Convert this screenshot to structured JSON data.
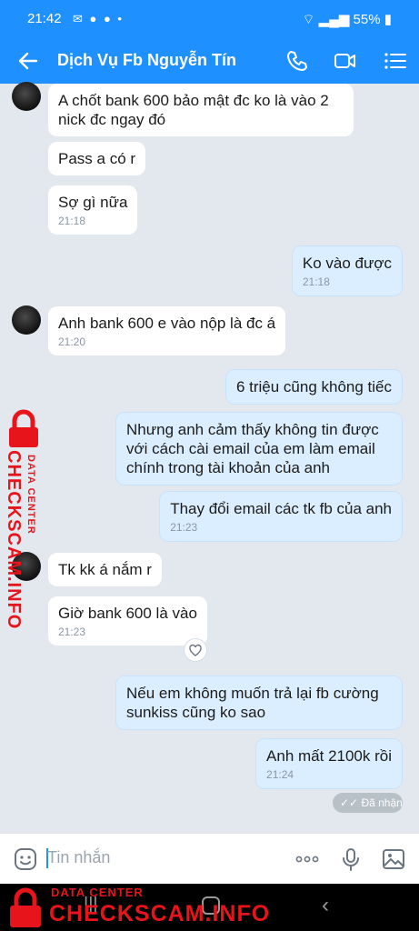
{
  "status_bar": {
    "time": "21:42",
    "battery": "55%"
  },
  "header": {
    "title": "Dịch Vụ Fb Nguyễn Tín"
  },
  "messages": [
    {
      "text": "A chốt bank 600 bảo mật đc ko là vào 2 nick đc ngay đó",
      "time": ""
    },
    {
      "text": "Pass a có r",
      "time": ""
    },
    {
      "text": "Sợ gì nữa",
      "time": "21:18"
    },
    {
      "text": "Ko vào được",
      "time": "21:18"
    },
    {
      "text": "Anh bank 600 e vào nộp là đc á",
      "time": "21:20"
    },
    {
      "text": "6 triệu cũng không tiếc",
      "time": ""
    },
    {
      "text": "Nhưng anh cảm thấy không tin được với cách cài email của em làm email chính trong tài khoản của anh",
      "time": ""
    },
    {
      "text": "Thay đổi email các tk fb của anh",
      "time": "21:23"
    },
    {
      "text": "Tk kk á nắm r",
      "time": ""
    },
    {
      "text": "Giờ bank 600 là vào",
      "time": "21:23"
    },
    {
      "text": "Nếu em không muốn trả lại fb cường sunkiss cũng ko sao",
      "time": ""
    },
    {
      "text": "Anh mất 2100k rồi",
      "time": "21:24"
    }
  ],
  "seen_label": "Đã nhận",
  "input": {
    "placeholder": "Tin nhắn"
  },
  "watermark": {
    "line1": "DATA CENTER",
    "line2": "CHECKSCAM.INFO"
  },
  "colors": {
    "accent": "#1e90ff",
    "outgoing_bubble": "#dbeeff",
    "watermark": "#e8141b"
  }
}
